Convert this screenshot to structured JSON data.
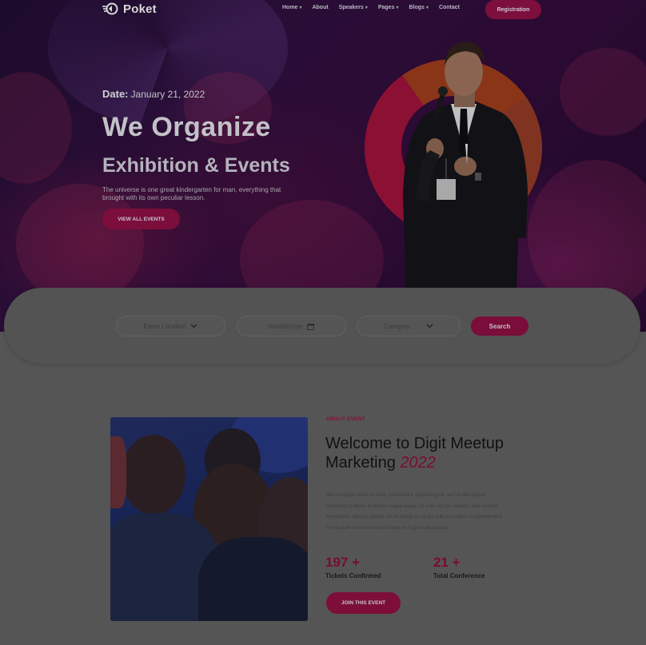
{
  "brand": {
    "name": "Poket"
  },
  "nav": {
    "items": [
      {
        "label": "Home",
        "has_dropdown": true
      },
      {
        "label": "About",
        "has_dropdown": false
      },
      {
        "label": "Speakers",
        "has_dropdown": true
      },
      {
        "label": "Pages",
        "has_dropdown": true
      },
      {
        "label": "Blogs",
        "has_dropdown": true
      },
      {
        "label": "Contact",
        "has_dropdown": false
      }
    ],
    "cta_label": "Registration"
  },
  "hero": {
    "date_label": "Date:",
    "date_value": "January 21, 2022",
    "headline": "We Organize",
    "subheadline": "Exhibition & Events",
    "tagline": "The universe is one great kindergarten for man, everything that brought with its own peculiar lesson.",
    "button_label": "VIEW ALL EVENTS"
  },
  "search": {
    "location_label": "Event Location",
    "date_placeholder": "mm/dd/yyyy",
    "category_label": "Category",
    "button_label": "Search"
  },
  "about": {
    "label": "ABOUT EVENT",
    "title_main": "Welcome to Digit Meetup Marketing",
    "title_year": "2022",
    "body": "We are ipsum dolor sit amet, consectetur adipisicing elit, sed do the tempor incididunt ut labore et dolore magna aliqua. Ut enim ad min veniam, quis nostrud exercitation ullamco laboris nisi ut aliquip ex ea qui aute irure dolor in reprehenderit in voluptate velit esse cillum dolore eu fugiat nulla pariatur.",
    "stats": [
      {
        "value": "197 +",
        "label": "Tickets Confirmed"
      },
      {
        "value": "21 +",
        "label": "Total Conference"
      }
    ],
    "button_label": "JOIN THIS EVENT"
  },
  "colors": {
    "accent": "#7b0e3b",
    "accent_dark_overlay": "#545454",
    "hero_bg": "#2a0d36"
  }
}
